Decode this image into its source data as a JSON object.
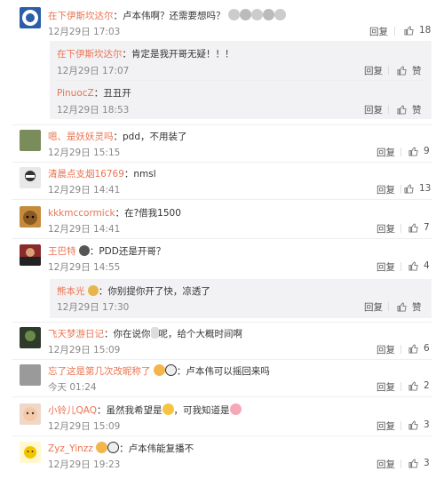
{
  "labels": {
    "reply": "回复",
    "like_text": "赞"
  },
  "comments": [
    {
      "user": "在下伊斯坎达尔",
      "text": "：卢本伟啊？还需要想吗？",
      "time": "12月29日 17:03",
      "likes": "18"
    },
    {
      "user": "嗯、是妖妖灵吗",
      "text": "：pdd，不用装了",
      "time": "12月29日 15:15",
      "likes": "9"
    },
    {
      "user": "清晨点支烟16769",
      "text": "：nmsl",
      "time": "12月29日 14:41",
      "likes": "13"
    },
    {
      "user": "kkkmccormick",
      "text": "：在?借我1500",
      "time": "12月29日 14:41",
      "likes": "7"
    },
    {
      "user": "王巴特",
      "text": "：PDD还是开哥？",
      "time": "12月29日 14:55",
      "likes": "4"
    },
    {
      "user": "飞天梦游日记",
      "text": "：你在说你",
      "text2": "呢，给个大概时间啊",
      "time": "12月29日 15:09",
      "likes": "6"
    },
    {
      "user": "忘了这是第几次改昵称了",
      "text": "：卢本伟可以摇回来吗",
      "time": "今天 01:24",
      "likes": "2"
    },
    {
      "user": "小铃儿QAQ",
      "text": "：虽然我希望是",
      "text2": "，可我知道是",
      "time": "12月29日 15:09",
      "likes": "3"
    },
    {
      "user": "Zyz_Yinzz",
      "text": "：卢本伟能复播不",
      "time": "12月29日 19:23",
      "likes": "3"
    }
  ],
  "subreplies": [
    {
      "user": "在下伊斯坎达尔",
      "text": "：肯定是我开哥无疑！！！",
      "time": "12月29日 17:07"
    },
    {
      "user": "PinuocZ",
      "text": "：丑丑开",
      "time": "12月29日 18:53"
    },
    {
      "user": "熊本光",
      "text": "：你别提你开了快，凉透了",
      "time": "12月29日 17:30"
    }
  ],
  "colors": {
    "username": "#eb7350",
    "subbox": "#f2f2f5"
  }
}
